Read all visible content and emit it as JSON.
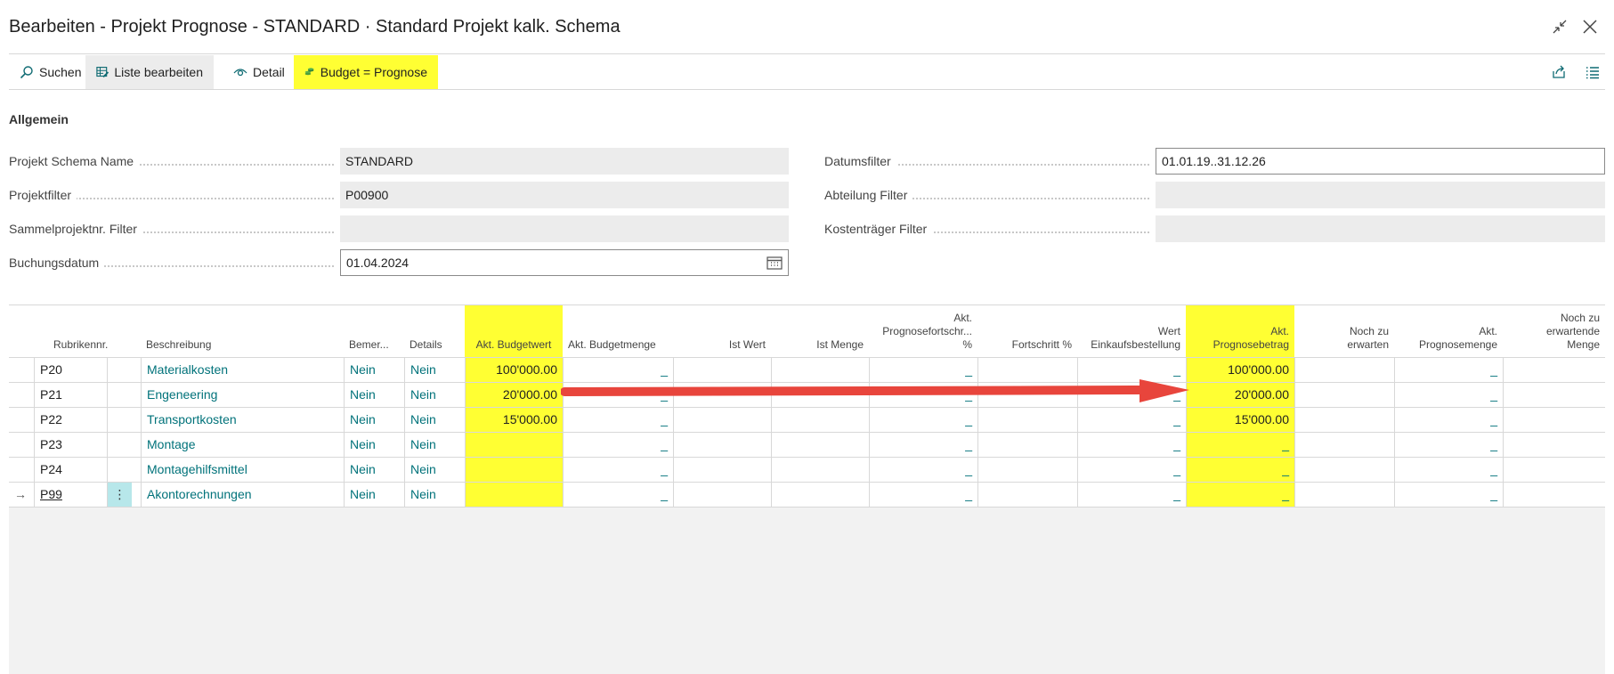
{
  "window": {
    "title": "Bearbeiten - Projekt Prognose - STANDARD · Standard Projekt kalk. Schema",
    "collapse_icon": "collapse-icon",
    "close_icon": "close-icon"
  },
  "actions": {
    "search_label": "Suchen",
    "edit_list_label": "Liste bearbeiten",
    "detail_label": "Detail",
    "budget_label": "Budget = Prognose"
  },
  "section": {
    "title": "Allgemein"
  },
  "fields": {
    "schema_name": {
      "label": "Projekt Schema Name",
      "value": "STANDARD"
    },
    "project_filter": {
      "label": "Projektfilter",
      "value": "P00900"
    },
    "collective_filter": {
      "label": "Sammelprojektnr. Filter",
      "value": ""
    },
    "posting_date": {
      "label": "Buchungsdatum",
      "value": "01.04.2024"
    },
    "date_filter": {
      "label": "Datumsfilter",
      "value": "01.01.19..31.12.26"
    },
    "department_filter": {
      "label": "Abteilung Filter",
      "value": ""
    },
    "cost_unit_filter": {
      "label": "Kostenträger Filter",
      "value": ""
    }
  },
  "table": {
    "headers": {
      "rubric": "Rubrikennr.",
      "description": "Beschreibung",
      "remark": "Bemer...",
      "details": "Details",
      "budget_value": "Akt. Budgetwert",
      "budget_qty": "Akt. Budgetmenge",
      "actual_value": "Ist Wert",
      "actual_qty": "Ist Menge",
      "forecast_progress": "Akt. Prognosefortschr... %",
      "progress": "Fortschritt %",
      "purchase_value": "Wert Einkaufsbestellung",
      "forecast_amount": "Akt. Prognosebetrag",
      "still_expected": "Noch zu erwarten",
      "forecast_qty": "Akt. Prognosemenge",
      "still_expected_qty": "Noch zu erwartende Menge"
    },
    "header_lines": {
      "forecast_progress_1": "Akt.",
      "forecast_progress_2": "Prognosefortschr...",
      "forecast_progress_3": "%",
      "purchase_value_1": "Wert",
      "purchase_value_2": "Einkaufsbestellung",
      "forecast_amount_1": "Akt.",
      "forecast_amount_2": "Prognosebetrag",
      "still_expected_1": "Noch zu",
      "still_expected_2": "erwarten",
      "forecast_qty_1": "Akt.",
      "forecast_qty_2": "Prognosemenge",
      "still_expected_qty_1": "Noch zu",
      "still_expected_qty_2": "erwartende",
      "still_expected_qty_3": "Menge"
    },
    "rows": [
      {
        "rubric": "P20",
        "description": "Materialkosten",
        "remark": "Nein",
        "details": "Nein",
        "budget_value": "100'000.00",
        "budget_qty": "_",
        "forecast_progress": "_",
        "purchase_value": "_",
        "forecast_amount": "100'000.00",
        "forecast_qty": "_"
      },
      {
        "rubric": "P21",
        "description": "Engeneering",
        "remark": "Nein",
        "details": "Nein",
        "budget_value": "20'000.00",
        "budget_qty": "_",
        "forecast_progress": "_",
        "purchase_value": "_",
        "forecast_amount": "20'000.00",
        "forecast_qty": "_"
      },
      {
        "rubric": "P22",
        "description": "Transportkosten",
        "remark": "Nein",
        "details": "Nein",
        "budget_value": "15'000.00",
        "budget_qty": "_",
        "forecast_progress": "_",
        "purchase_value": "_",
        "forecast_amount": "15'000.00",
        "forecast_qty": "_"
      },
      {
        "rubric": "P23",
        "description": "Montage",
        "remark": "Nein",
        "details": "Nein",
        "budget_value": "",
        "budget_qty": "_",
        "forecast_progress": "_",
        "purchase_value": "_",
        "forecast_amount": "_",
        "forecast_qty": "_"
      },
      {
        "rubric": "P24",
        "description": "Montagehilfsmittel",
        "remark": "Nein",
        "details": "Nein",
        "budget_value": "",
        "budget_qty": "_",
        "forecast_progress": "_",
        "purchase_value": "_",
        "forecast_amount": "_",
        "forecast_qty": "_"
      },
      {
        "rubric": "P99",
        "description": "Akontorechnungen",
        "remark": "Nein",
        "details": "Nein",
        "budget_value": "",
        "budget_qty": "_",
        "forecast_progress": "_",
        "purchase_value": "_",
        "forecast_amount": "_",
        "forecast_qty": "_"
      }
    ],
    "current_row_marker": "→",
    "row_menu_glyph": "⋮"
  },
  "colors": {
    "highlight": "#ffff33",
    "link": "#00727a",
    "arrow": "#e8453c"
  }
}
